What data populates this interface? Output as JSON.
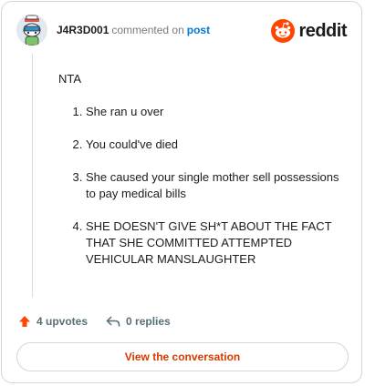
{
  "comment": {
    "author": "J4R3D001",
    "action": "commented on",
    "post_link": "post",
    "intro": "NTA",
    "items": [
      "She ran u over",
      "You could've died",
      "She caused your single mother sell possessions to pay medical bills",
      "SHE DOESN'T GIVE SH*T ABOUT THE FACT THAT SHE COMMITTED ATTEMPTED VEHICULAR MANSLAUGHTER"
    ]
  },
  "brand": {
    "name": "reddit",
    "color": "#ff4500"
  },
  "footer": {
    "upvotes": "4 upvotes",
    "replies": "0 replies",
    "upvote_color": "#ff4500"
  },
  "cta": {
    "label": "View the conversation"
  }
}
